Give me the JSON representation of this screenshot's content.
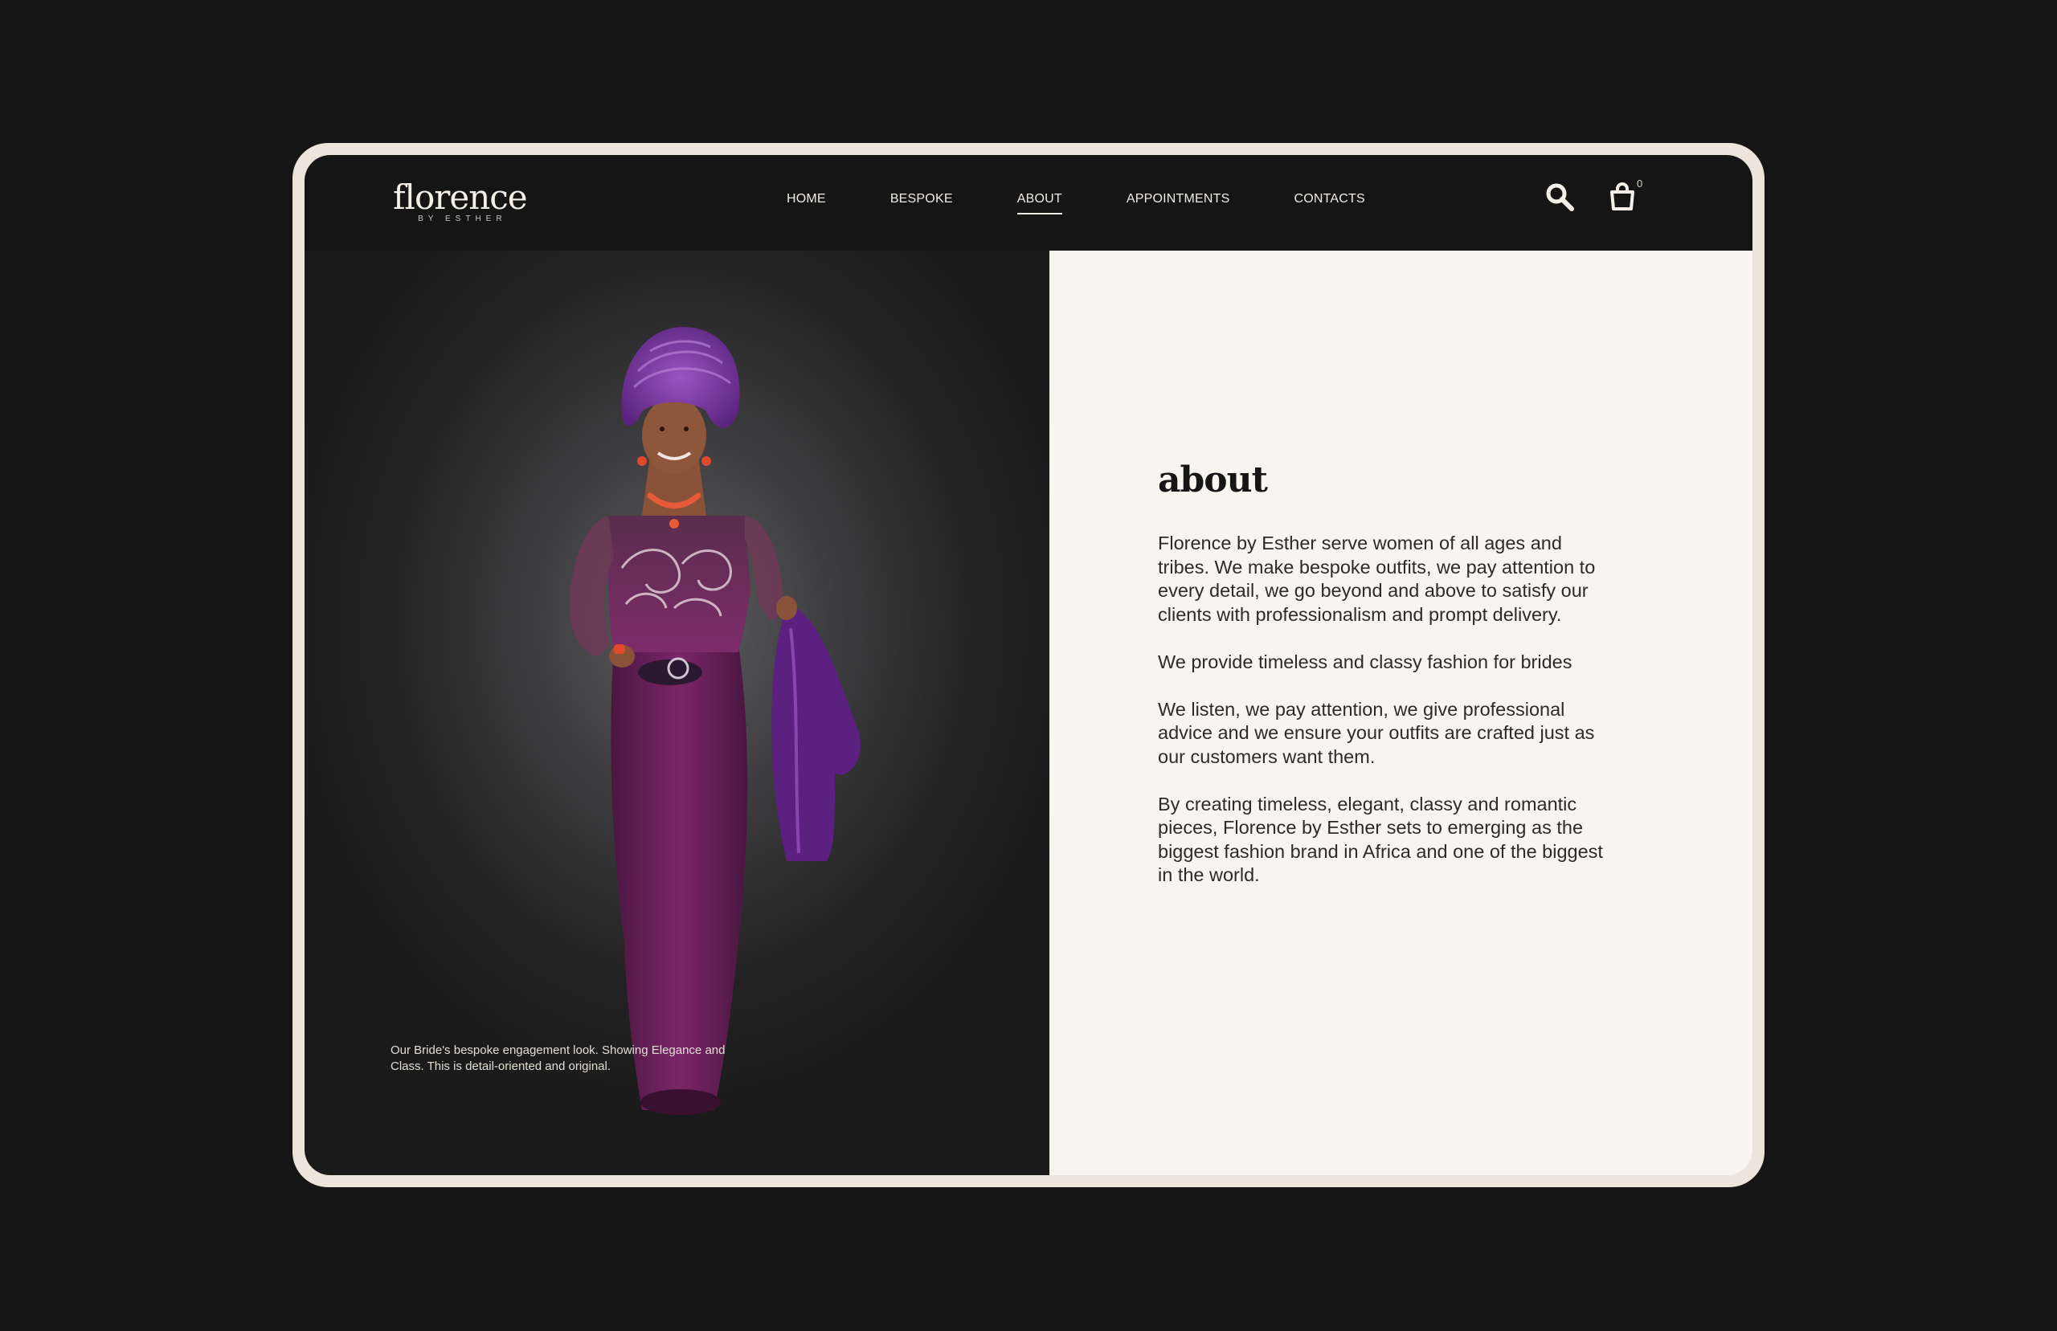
{
  "brand": {
    "name": "florence",
    "tagline": "BY ESTHER"
  },
  "nav": {
    "items": [
      {
        "label": "HOME",
        "active": false
      },
      {
        "label": "BESPOKE",
        "active": false
      },
      {
        "label": "ABOUT",
        "active": true
      },
      {
        "label": "APPOINTMENTS",
        "active": false
      },
      {
        "label": "CONTACTS",
        "active": false
      }
    ],
    "cart_count": "0",
    "icons": {
      "search": "search-icon",
      "cart": "shopping-bag-icon"
    }
  },
  "hero": {
    "caption": "Our Bride's  bespoke engagement look. Showing Elegance and Class. This is detail-oriented and original."
  },
  "about": {
    "title": "about",
    "paragraphs": [
      "Florence by Esther serve women of all ages and tribes. We make bespoke outfits, we pay attention to every detail, we go beyond and above to satisfy our clients with professionalism and prompt delivery.",
      "We provide timeless and classy fashion for brides",
      "We listen, we pay attention, we give professional advice and we ensure your outfits are crafted just as our customers want them.",
      "By creating timeless, elegant, classy and romantic pieces, Florence by Esther sets to emerging as the biggest fashion brand in Africa and one of the biggest in the world."
    ]
  },
  "colors": {
    "background": "#151515",
    "frame": "#ebe5dc",
    "panel": "#f8f5f1",
    "dress": "#6b1f5c",
    "gele": "#7b3a9e"
  }
}
